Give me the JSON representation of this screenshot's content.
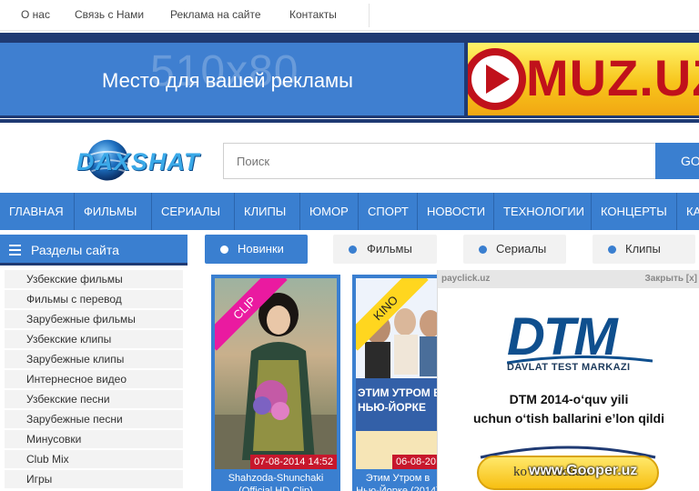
{
  "toplinks": [
    "О нас",
    "Связь с Нами",
    "Реклама на сайте",
    "Контакты"
  ],
  "ads": {
    "left_ghost": "510x80",
    "left_text": "Место для вашей рекламы",
    "right_logo": "MUZ.UZ"
  },
  "header": {
    "logo_text": "DAXSHAT",
    "search_placeholder": "Поиск",
    "search_button": "GO"
  },
  "mainnav": [
    "ГЛАВНАЯ",
    "ФИЛЬМЫ",
    "СЕРИАЛЫ",
    "КЛИПЫ",
    "ЮМОР",
    "СПОРТ",
    "НОВОСТИ",
    "ТЕХНОЛОГИИ",
    "КОНЦЕРТЫ",
    "КА"
  ],
  "sidebar": {
    "title": "Разделы сайта",
    "items": [
      "Узбекские фильмы",
      "Фильмы с перевод",
      "Зарубежные фильмы",
      "Узбекские клипы",
      "Зарубежные клипы",
      "Интернесное видео",
      "Узбекские песни",
      "Зарубежные песни",
      "Минусовки",
      "Club Mix",
      "Игры"
    ]
  },
  "tabs": [
    "Новинки",
    "Фильмы",
    "Сериалы",
    "Клипы"
  ],
  "cards": [
    {
      "ribbon": "CLIP",
      "date": "07-08-2014 14:52",
      "caption": "Shahzoda-Shunchaki (Official HD Clip)"
    },
    {
      "ribbon": "KINO",
      "date": "06-08-20",
      "caption": "Этим Утром в Нью-Йорке (2014)",
      "poster": "ЭТИМ УТРОМ В НЬЮ-ЙОРКЕ"
    }
  ],
  "popup": {
    "source": "payclick.uz",
    "close": "Закрыть [x]",
    "brand": "DTM",
    "brand_sub": "DAVLAT TEST MARKAZI",
    "line1": "DTM 2014-o‘quv yili",
    "line2": "uchun o‘tish ballarini e’lon qildi",
    "button": "ko‘rish uchun"
  },
  "watermark": "www.Gooper.uz",
  "colors": {
    "blue": "#3a7fd0",
    "navy": "#1f3a73",
    "date_red": "#c7172c",
    "ribbon_pink": "#ea1aa0",
    "ribbon_yellow": "#ffd61f"
  }
}
